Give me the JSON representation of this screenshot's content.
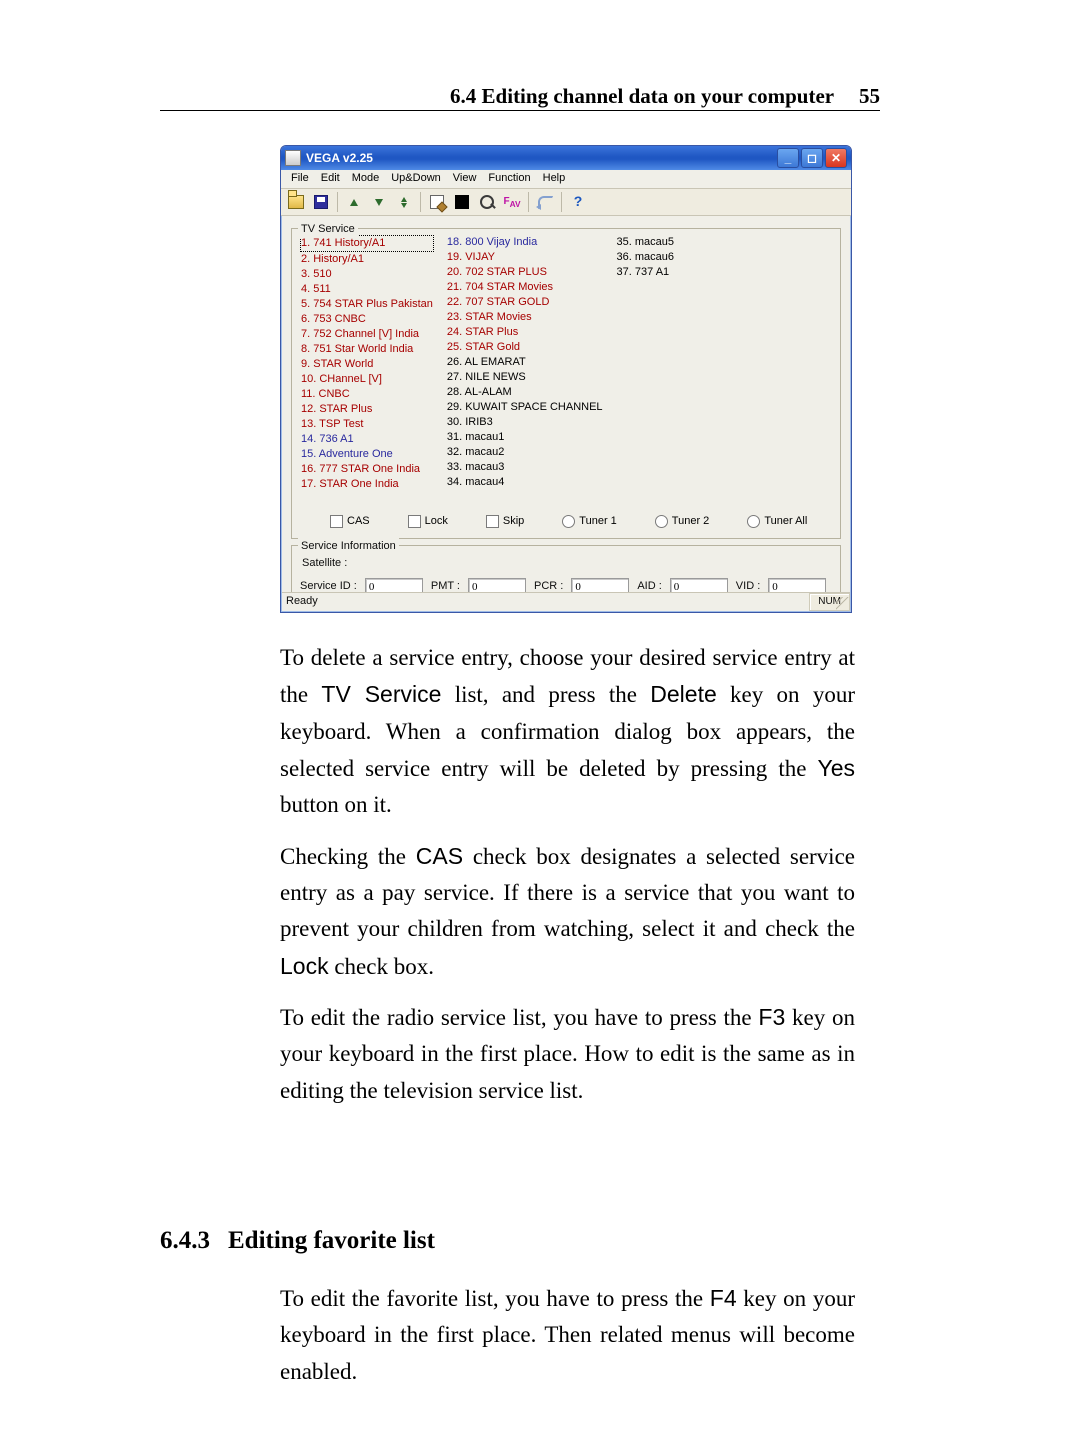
{
  "page": {
    "running_head": "6.4 Editing channel data on your computer",
    "page_number": "55"
  },
  "window": {
    "title": "VEGA v2.25",
    "menu": [
      "File",
      "Edit",
      "Mode",
      "Up&Down",
      "View",
      "Function",
      "Help"
    ],
    "status_left": "Ready",
    "status_caps": "NUM"
  },
  "tvservice": {
    "legend": "TV Service",
    "col1": [
      {
        "text": "1. 741 History/A1",
        "color": "red",
        "selected": true
      },
      {
        "text": "2. History/A1",
        "color": "red"
      },
      {
        "text": "3. 510",
        "color": "red"
      },
      {
        "text": "4. 511",
        "color": "red"
      },
      {
        "text": "5. 754 STAR Plus Pakistan",
        "color": "red"
      },
      {
        "text": "6. 753 CNBC",
        "color": "red"
      },
      {
        "text": "7. 752 Channel [V] India",
        "color": "red"
      },
      {
        "text": "8. 751 Star World India",
        "color": "red"
      },
      {
        "text": "9. STAR World",
        "color": "red"
      },
      {
        "text": "10. CHanneL [V]",
        "color": "red"
      },
      {
        "text": "11. CNBC",
        "color": "red"
      },
      {
        "text": "12. STAR Plus",
        "color": "red"
      },
      {
        "text": "13. TSP Test",
        "color": "red"
      },
      {
        "text": "14. 736 A1",
        "color": "blue"
      },
      {
        "text": "15. Adventure One",
        "color": "blue"
      },
      {
        "text": "16. 777 STAR One India",
        "color": "red"
      },
      {
        "text": "17. STAR One India",
        "color": "red"
      }
    ],
    "col2": [
      {
        "text": "18. 800 Vijay India",
        "color": "blue"
      },
      {
        "text": "19. VIJAY",
        "color": "red"
      },
      {
        "text": "20. 702 STAR PLUS",
        "color": "red"
      },
      {
        "text": "21. 704 STAR Movies",
        "color": "red"
      },
      {
        "text": "22. 707 STAR GOLD",
        "color": "red"
      },
      {
        "text": "23. STAR Movies",
        "color": "red"
      },
      {
        "text": "24. STAR Plus",
        "color": "red"
      },
      {
        "text": "25. STAR Gold",
        "color": "red"
      },
      {
        "text": "26. AL EMARAT",
        "color": "black"
      },
      {
        "text": "27. NILE NEWS",
        "color": "black"
      },
      {
        "text": "28. AL-ALAM",
        "color": "black"
      },
      {
        "text": "29. KUWAIT SPACE CHANNEL",
        "color": "black"
      },
      {
        "text": "30. IRIB3",
        "color": "black"
      },
      {
        "text": "31. macau1",
        "color": "black"
      },
      {
        "text": "32. macau2",
        "color": "black"
      },
      {
        "text": "33. macau3",
        "color": "black"
      },
      {
        "text": "34. macau4",
        "color": "black"
      }
    ],
    "col3": [
      {
        "text": "35. macau5",
        "color": "black"
      },
      {
        "text": "36. macau6",
        "color": "black"
      },
      {
        "text": "37. 737 A1",
        "color": "black"
      }
    ]
  },
  "controls": {
    "cas": "CAS",
    "lock": "Lock",
    "skip": "Skip",
    "tuner1": "Tuner 1",
    "tuner2": "Tuner 2",
    "tunerall": "Tuner All"
  },
  "serviceinfo": {
    "legend": "Service Information",
    "satellite_label": "Satellite :",
    "service_id_label": "Service ID :",
    "pmt_label": "PMT :",
    "pcr_label": "PCR :",
    "aid_label": "AID :",
    "vid_label": "VID :",
    "placeholder": "0"
  },
  "para": {
    "p1a": "To delete a service entry, choose your desired service entry at the ",
    "p1b": "TV Service",
    "p1c": " list, and press the ",
    "p1d": "Delete",
    "p1e": " key on your keyboard. When a confirmation dialog box appears, the selected service entry will be deleted by pressing the ",
    "p1f": "Yes",
    "p1g": " button on it.",
    "p2a": "Checking the ",
    "p2b": "CAS",
    "p2c": " check box designates a selected service entry as a pay service. If there is a service that you want to prevent your children from watching, select it and check the ",
    "p2d": "Lock",
    "p2e": " check box.",
    "p3a": "To edit the radio service list, you have to press the ",
    "p3b": "F3",
    "p3c": " key on your keyboard in the first place. How to edit is the same as in editing the television service list.",
    "p4a": "To edit the favorite list, you have to press the ",
    "p4b": "F4",
    "p4c": " key on your keyboard in the first place. Then related menus will become enabled."
  },
  "section": {
    "num": "6.4.3",
    "title": "Editing favorite list"
  }
}
